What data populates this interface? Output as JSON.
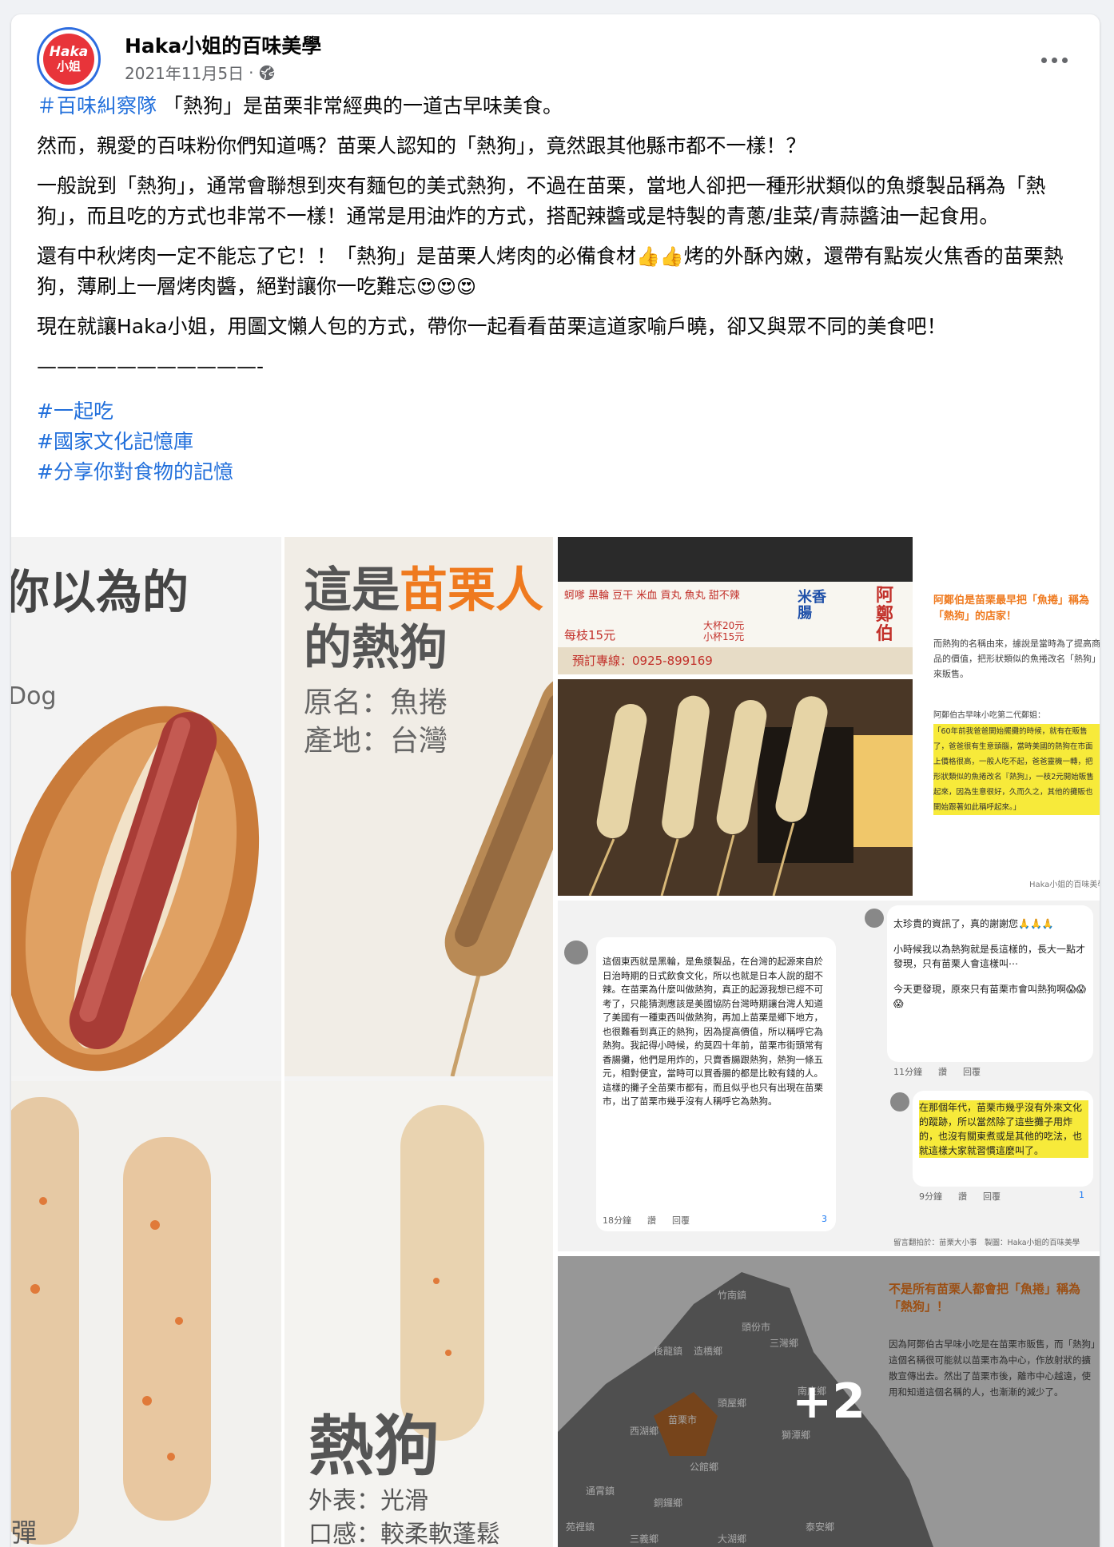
{
  "header": {
    "avatar_line1": "Haka",
    "avatar_line2": "小姐",
    "page_name": "Haka小姐的百味美學",
    "date": "2021年11月5日",
    "separator": "·"
  },
  "post": {
    "p1_hashtag": "＃百味糾察隊",
    "p1_text": " 「熱狗」是苗栗非常經典的一道古早味美食。",
    "p2": "然而，親愛的百味粉你們知道嗎？苗栗人認知的「熱狗」，竟然跟其他縣市都不一樣！？",
    "p3": "一般說到「熱狗」，通常會聯想到夾有麵包的美式熱狗，不過在苗栗，當地人卻把一種形狀類似的魚漿製品稱為「熱狗」，而且吃的方式也非常不一樣！通常是用油炸的方式，搭配辣醬或是特製的青蔥/韭菜/青蒜醬油一起食用。",
    "p4a": "還有中秋烤肉一定不能忘了它！！「熱狗」是苗栗人烤肉的必備食材",
    "p4_emoji1": "👍👍",
    "p4b": "烤的外酥內嫩，還帶有點炭火焦香的苗栗熱狗，薄刷上一層烤肉醬，絕對讓你一吃難忘",
    "p4_emoji2": "😍😍😍",
    "p5": "現在就讓Haka小姐，用圖文懶人包的方式，帶你一起看看苗栗這道家喻戶曉，卻又與眾不同的美食吧！",
    "rule": "———————————-",
    "tags": [
      "#一起吃",
      "#國家文化記憶庫",
      "#分享你對食物的記憶"
    ]
  },
  "gallery": {
    "main": {
      "tl_heading": "你以為的",
      "tl_sub1": "Dog",
      "tr_heading_a": "這是",
      "tr_heading_orange": "苗栗人",
      "tr_heading_b": "的熱狗",
      "tr_line1": "原名：魚捲",
      "tr_line2": "產地：台灣",
      "br_heading": "熱狗",
      "br_line1": "外表：光滑",
      "br_line2": "口感：較柔軟蓬鬆",
      "bl_line1": "彈"
    },
    "thumb1": {
      "menu_right": "阿鄭伯",
      "menu_mid": "米香腸",
      "price1": "每枝15元",
      "phone": "預訂專線：0925-899169",
      "cup1": "大杯20元",
      "cup2": "小杯15元"
    },
    "thumb2": {
      "title": "阿鄭伯是苗栗最早把「魚捲」稱為「熱狗」的店家！",
      "body": "而熱狗的名稱由來，據說是當時為了提高商品的價值，把形狀類似的魚捲改名「熱狗」來販售。",
      "quote_label": "阿鄭伯古早味小吃第二代鄭姐：",
      "quote": "「60年前我爸爸開始擺攤的時候，就有在販售了，爸爸很有生意頭腦，當時美國的熱狗在市面上價格很高，一般人吃不起，爸爸靈機一轉，把形狀類似的魚捲改名『熱狗』，一枝2元開始販售起來，因為生意很好，久而久之，其他的攤販也開始跟著如此稱呼起來。」",
      "footer": "Haka小姐的百味美學"
    },
    "thumb3": {
      "c1": "這個東西就是黑輪，是魚漿製品，在台灣的起源來自於日治時期的日式飲食文化，所以也就是日本人說的甜不辣。在苗栗為什麼叫做熱狗，真正的起源我想已經不可考了，只能猜測應該是美國協防台灣時期讓台灣人知道了美國有一種東西叫做熱狗，再加上苗栗是鄉下地方，也很難看到真正的熱狗，因為提高價值，所以稱呼它為熱狗。我記得小時候，約莫四十年前，苗栗市街頭常有香腸攤，他們是用炸的，只賣香腸跟熱狗，熱狗一條五元，相對便宜，當時可以買香腸的都是比較有錢的人。這樣的攤子全苗栗市都有，而且似乎也只有出現在苗栗市，出了苗栗市幾乎沒有人稱呼它為熱狗。",
      "c1_meta": "18分鐘",
      "c1_like": "讚",
      "c1_reply": "回覆",
      "c1_count": "3",
      "c2": "太珍貴的資訊了，真的謝謝您🙏🙏🙏",
      "c2b": "小時候我以為熱狗就是長這樣的，長大一點才發現，只有苗栗人會這樣叫⋯",
      "c2c": "今天更發現，原來只有苗栗市會叫熱狗啊😱😱😱",
      "c2_meta": "11分鐘",
      "c2_like": "讚",
      "c2_reply": "回覆",
      "c3": "在那個年代，苗栗市幾乎沒有外來文化的蹤跡，所以當然除了這些攤子用炸的，也沒有關東煮或是其他的吃法，也就這樣大家就習慣這麼叫了。",
      "c3_meta": "9分鐘",
      "c3_like": "讚",
      "c3_reply": "回覆",
      "c3_count": "1",
      "footer": "留言翻拍於：苗栗大小事　製圖：Haka小姐的百味美學"
    },
    "thumb4": {
      "title": "不是所有苗栗人都會把「魚捲」稱為「熱狗」！",
      "body": "因為阿鄭伯古早味小吃是在苗栗市販售，而「熱狗」這個名稱很可能就以苗栗市為中心，作放射狀的擴散宣傳出去。然出了苗栗市後，離市中心越遠，使用和知道這個名稱的人，也漸漸的減少了。",
      "more": "+2",
      "towns": [
        "竹南鎮",
        "頭份市",
        "三灣鄉",
        "後龍鎮",
        "造橋鄉",
        "苗栗市",
        "西湖鄉",
        "頭屋鄉",
        "公館鄉",
        "獅潭鄉",
        "銅鑼鄉",
        "南庄鄉",
        "通霄鎮",
        "苑裡鎮",
        "三義鄉",
        "大湖鄉",
        "泰安鄉"
      ]
    }
  }
}
